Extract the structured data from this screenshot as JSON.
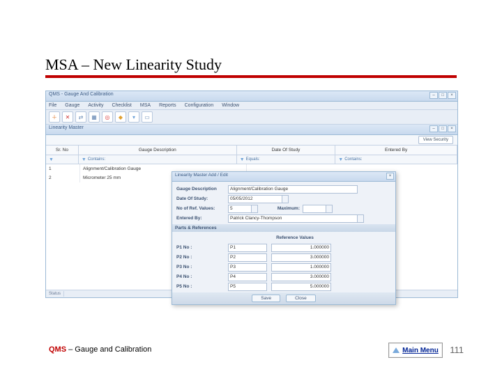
{
  "slide": {
    "title": "MSA – New Linearity Study",
    "footer_product": "QMS",
    "footer_module": " – Gauge and Calibration",
    "main_menu": "Main Menu",
    "page_number": "111"
  },
  "app": {
    "title": "QMS - Gauge And Calibration",
    "menubar": [
      "File",
      "Gauge",
      "Activity",
      "Checklist",
      "MSA",
      "Reports",
      "Configuration",
      "Window"
    ],
    "toolbar_icons": [
      "plus",
      "x",
      "arrows",
      "grid",
      "target",
      "shield",
      "funnel",
      "calendar"
    ],
    "sub_title": "Linearity Master",
    "view_security": "View Security",
    "headers": [
      "Sr. No",
      "Gauge Description",
      "Date Of Study",
      "Entered By"
    ],
    "filter_contains": "Contains:",
    "filter_equals": "Equals:",
    "rows": [
      {
        "srno": "1",
        "desc": "Alignment/Calibration Gauge"
      },
      {
        "srno": "2",
        "desc": "Micrometer 25 mm"
      }
    ],
    "status": "Status"
  },
  "modal": {
    "title": "Linearity Master Add / Edit",
    "labels": {
      "gauge_desc": "Gauge Description",
      "date_of_study": "Date Of Study:",
      "noof_ref": "No of Ref. Values:",
      "max": "Maximum:",
      "entered_by": "Entered By:"
    },
    "values": {
      "gauge_desc": "Alignment/Calibration Gauge",
      "date_of_study": "05/05/2012",
      "noof_ref": "5",
      "max": "",
      "entered_by": "Patrick Clancy-Thompson"
    },
    "parts_section": "Parts & References",
    "ref_head": "Reference Values",
    "parts": [
      {
        "label": "P1 No :",
        "name": "P1",
        "ref": "1.000000"
      },
      {
        "label": "P2 No :",
        "name": "P2",
        "ref": "3.000000"
      },
      {
        "label": "P3 No :",
        "name": "P3",
        "ref": "1.000000"
      },
      {
        "label": "P4 No :",
        "name": "P4",
        "ref": "3.000000"
      },
      {
        "label": "P5 No :",
        "name": "P5",
        "ref": "5.000000"
      }
    ],
    "buttons": {
      "save": "Save",
      "close": "Close"
    }
  }
}
